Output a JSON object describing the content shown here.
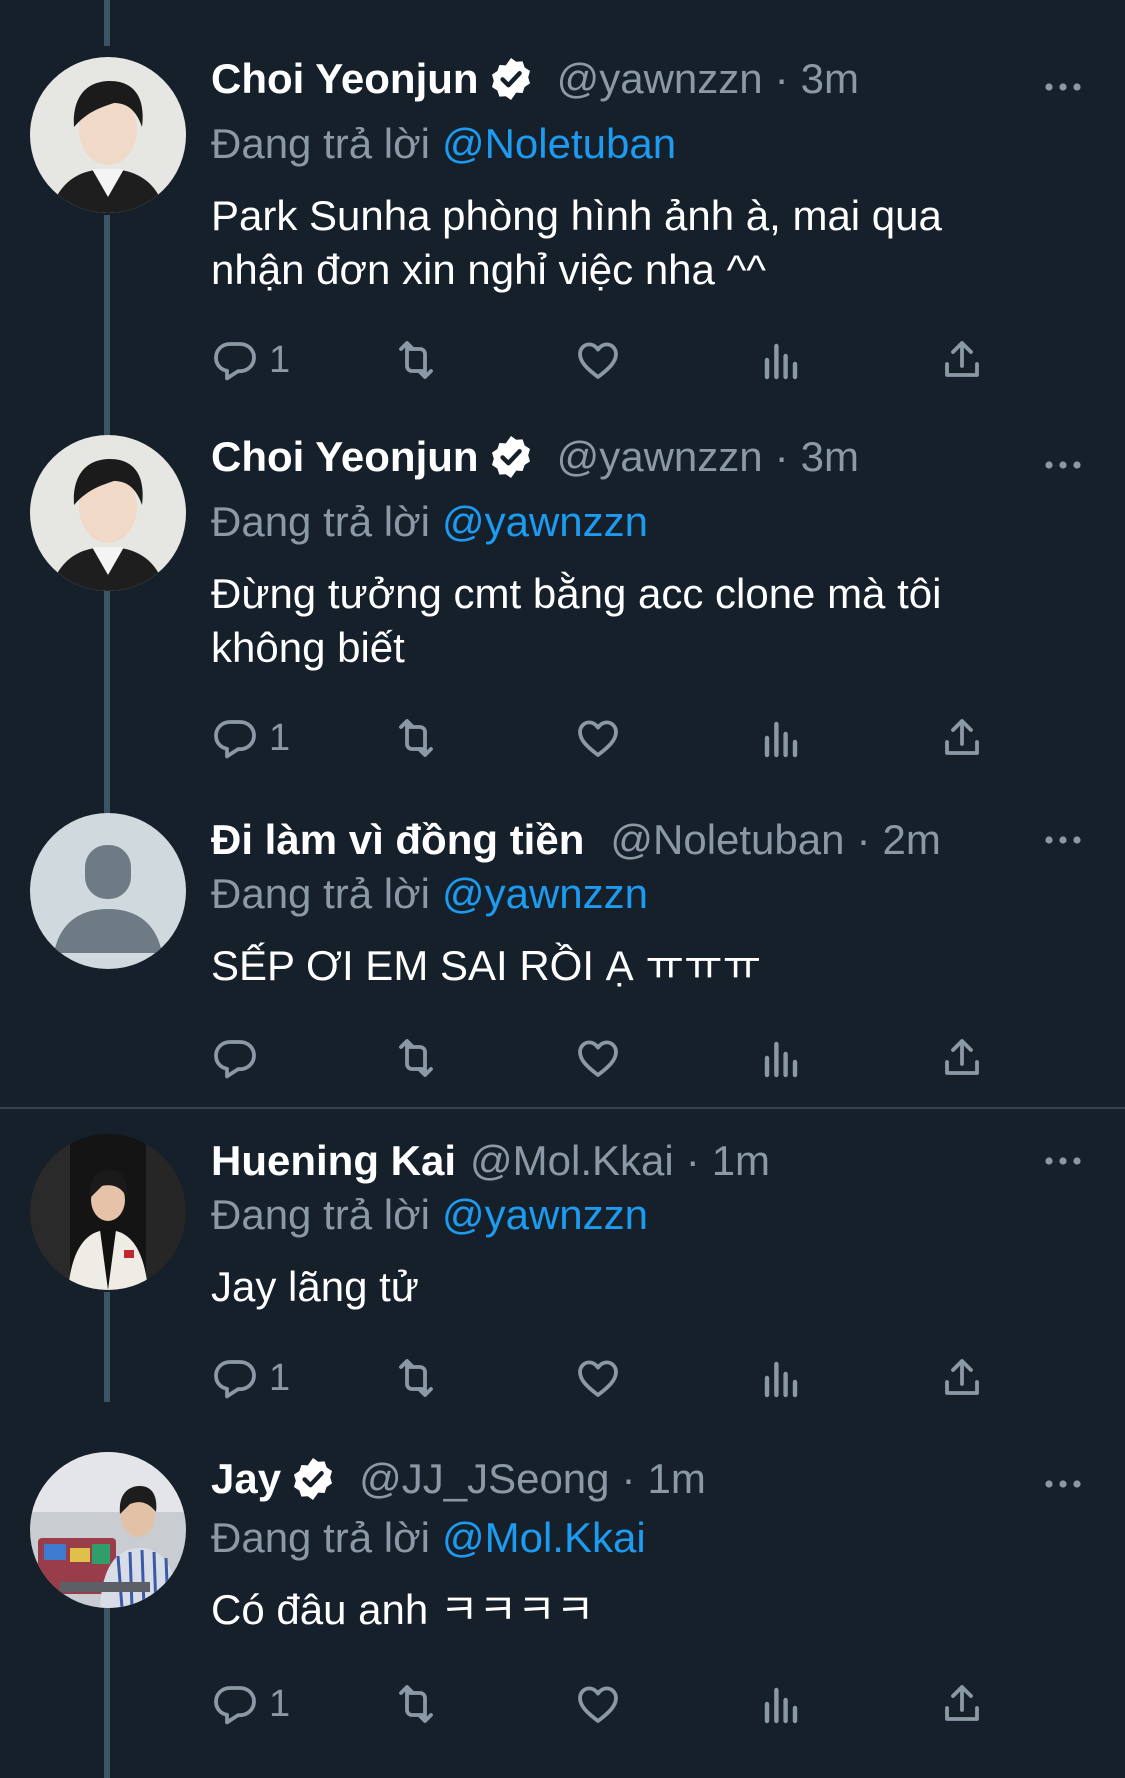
{
  "locale_reply_prefix": "Đang trả lời",
  "colors": {
    "background": "#15202b",
    "text_primary": "#ffffff",
    "text_secondary": "#8b98a5",
    "mention": "#1d9bf0",
    "thread_line": "#3d5466"
  },
  "tweets": [
    {
      "display_name": "Choi Yeonjun",
      "verified": true,
      "handle": "@yawnzzn",
      "time": "3m",
      "reply_to": "@Noletuban",
      "text": "Park Sunha phòng hình ảnh à, mai qua nhận đơn xin nghỉ việc nha ^^",
      "reply_count": "1",
      "avatar": "photo-avatar"
    },
    {
      "display_name": "Choi Yeonjun",
      "verified": true,
      "handle": "@yawnzzn",
      "time": "3m",
      "reply_to": "@yawnzzn",
      "text": "Đừng tưởng cmt bằng acc clone mà tôi không biết",
      "reply_count": "1",
      "avatar": "photo-avatar"
    },
    {
      "display_name": "Đi làm vì đồng tiền",
      "verified": false,
      "handle": "@Noletuban",
      "time": "2m",
      "reply_to": "@yawnzzn",
      "text": "SẾP ƠI EM SAI RỒI Ạ ㅠㅠㅠ",
      "reply_count": "",
      "avatar": "default-avatar"
    },
    {
      "display_name": "Huening Kai",
      "verified": false,
      "handle": "@Mol.Kkai",
      "time": "1m",
      "reply_to": "@yawnzzn",
      "text": "Jay lãng tử",
      "reply_count": "1",
      "avatar": "photo-avatar"
    },
    {
      "display_name": "Jay",
      "verified": true,
      "handle": "@JJ_JSeong",
      "time": "1m",
      "reply_to": "@Mol.Kkai",
      "text": "Có đâu anh ㅋㅋㅋㅋ",
      "reply_count": "1",
      "avatar": "photo-avatar"
    }
  ]
}
